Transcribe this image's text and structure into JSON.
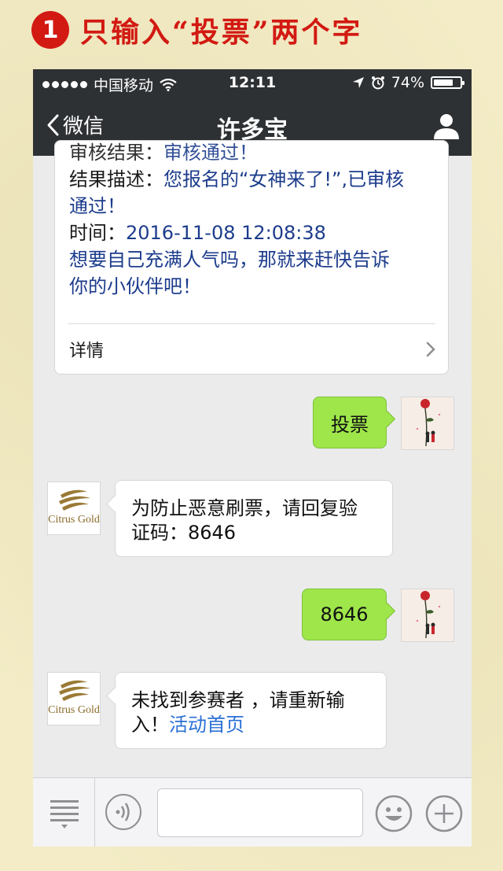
{
  "caption": {
    "step": "1",
    "text": "只输入“投票”两个字",
    "badge_color": "#d21a12"
  },
  "statusbar": {
    "carrier": "中国移动",
    "time": "12:11",
    "battery": "74%",
    "battery_level": 0.74
  },
  "navbar": {
    "back_label": "微信",
    "title": "许多宝"
  },
  "card": {
    "partial_label": "审核结果：",
    "partial_value": "审核通过！",
    "desc_label": "结果描述：",
    "desc_value_1": "您报名的“女神来了!”,已审核",
    "desc_value_2": "通过！",
    "time_label": "时间：",
    "time_value": "2016-11-08 12:08:38",
    "promo_1": "想要自己充满人气吗，那就来赶快告诉",
    "promo_2": "你的小伙伴吧！",
    "detail_label": "详情"
  },
  "messages": [
    {
      "side": "out",
      "text": "投票"
    },
    {
      "side": "in",
      "sender": "Citrus Gold",
      "line1": "为防止恶意刷票，请回复验",
      "line2": "证码：8646"
    },
    {
      "side": "out",
      "text": "8646"
    },
    {
      "side": "in",
      "sender": "Citrus Gold",
      "line1": "未找到参赛者 ，请重新输",
      "line2_prefix": "入！",
      "link": "活动首页"
    }
  ],
  "colors": {
    "nav_bg": "#2e3134",
    "bubble_out": "#9ee64a",
    "link": "#2b6fd6",
    "card_text": "#1c3c8c"
  }
}
